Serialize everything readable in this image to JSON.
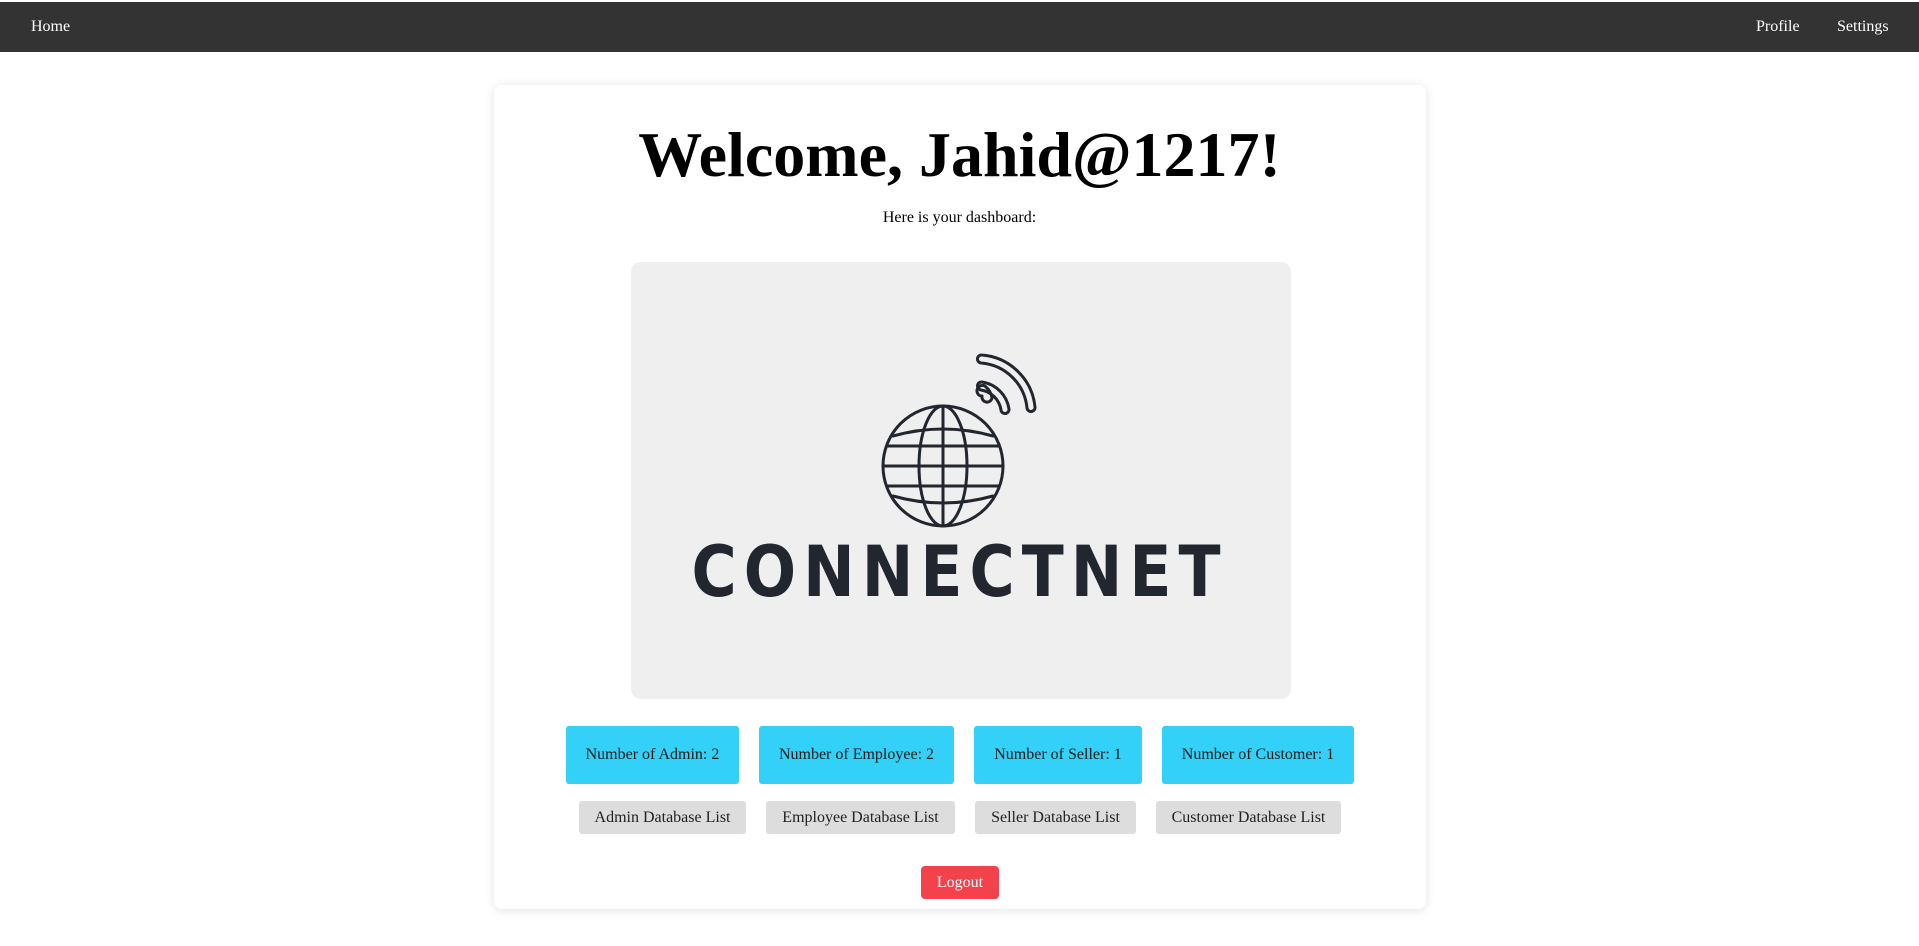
{
  "nav": {
    "home": "Home",
    "profile": "Profile",
    "settings": "Settings"
  },
  "main": {
    "welcome": "Welcome, Jahid@1217!",
    "subtitle": "Here is your dashboard:",
    "logo_text": "CONNECTNET",
    "logo_icon": "globe-wifi-icon"
  },
  "stats": {
    "admin": "Number of Admin: 2",
    "employee": "Number of Employee: 2",
    "seller": "Number of Seller: 1",
    "customer": "Number of Customer: 1"
  },
  "database_buttons": {
    "admin": "Admin Database List",
    "employee": "Employee Database List",
    "seller": "Seller Database List",
    "customer": "Customer Database List"
  },
  "logout_label": "Logout",
  "colors": {
    "navbar": "#333333",
    "stat_bg": "#33d1f7",
    "db_button_bg": "#dddddd",
    "logout_bg": "#f4424c",
    "logo_bg": "#efefef",
    "logo_ink": "#22262e"
  }
}
